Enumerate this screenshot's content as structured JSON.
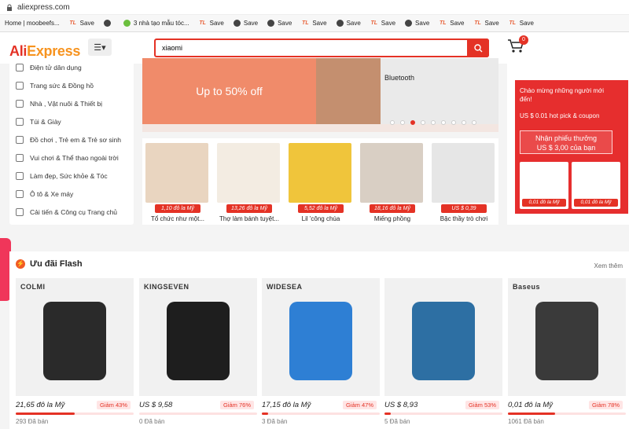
{
  "browser": {
    "url": "aliexpress.com",
    "bookmarks": [
      {
        "icon": "home-icon",
        "label": "Home | moobeefs..."
      },
      {
        "icon": "tl-icon",
        "label": "Save"
      },
      {
        "icon": "globe-icon",
        "label": ""
      },
      {
        "icon": "check-icon",
        "label": "3 nhà tạo mẫu tóc..."
      },
      {
        "icon": "tl-icon",
        "label": "Save"
      },
      {
        "icon": "globe-icon",
        "label": "Save"
      },
      {
        "icon": "globe-icon",
        "label": "Save"
      },
      {
        "icon": "tl-icon",
        "label": "Save"
      },
      {
        "icon": "globe-icon",
        "label": "Save"
      },
      {
        "icon": "tl-icon",
        "label": "Save"
      },
      {
        "icon": "globe-icon",
        "label": "Save"
      },
      {
        "icon": "tl-icon",
        "label": "Save"
      },
      {
        "icon": "tl-icon",
        "label": "Save"
      },
      {
        "icon": "tl-icon",
        "label": "Save"
      }
    ]
  },
  "header": {
    "logo_main": "Ali",
    "logo_accent": "Express",
    "search_value": "xiaomi",
    "cart_count": "0"
  },
  "sidebar": {
    "items": [
      {
        "icon": "camera-icon",
        "label": "Điện tử dân dụng"
      },
      {
        "icon": "ring-icon",
        "label": "Trang sức & Đồng hồ"
      },
      {
        "icon": "home-icon",
        "label": "Nhà , Vật nuôi & Thiết bị"
      },
      {
        "icon": "bag-icon",
        "label": "Túi & Giày"
      },
      {
        "icon": "toy-icon",
        "label": "Đồ chơi , Trẻ em & Trẻ sơ sinh"
      },
      {
        "icon": "ball-icon",
        "label": "Vui chơi & Thể thao ngoài trời"
      },
      {
        "icon": "beauty-icon",
        "label": "Làm đẹp, Sức khỏe & Tóc"
      },
      {
        "icon": "car-icon",
        "label": "Ô tô & Xe máy"
      },
      {
        "icon": "tool-icon",
        "label": "Cải tiến & Công cụ Trang chủ"
      }
    ]
  },
  "banner": {
    "promo_text": "Up to 50% off",
    "product_label": "Bluetooth"
  },
  "strip": [
    {
      "tag": "1,10 đô la Mỹ",
      "name": "Tổ chức như một...",
      "color": "#e9d5c0"
    },
    {
      "tag": "13,26 đô la Mỹ",
      "name": "Thợ làm bánh tuyệt...",
      "color": "#f3ece2"
    },
    {
      "tag": "5,52 đô la Mỹ",
      "name": "Lil 'công chúa",
      "color": "#f0c53b"
    },
    {
      "tag": "18,16 đô la Mỹ",
      "name": "Miếng phồng",
      "color": "#d9cfc4"
    },
    {
      "tag": "US $ 0,39",
      "name": "Bậc thầy trò chơi",
      "color": "#e6e6e6"
    }
  ],
  "promo": {
    "welcome": "Chào mừng những người mới đến!",
    "deal": "US $ 0.01 hot pick & coupon",
    "coupon_line1": "Nhận phiếu thưởng",
    "coupon_line2": "US $ 3,00 của bạn",
    "mini_tags": [
      "0,01 đô la Mỹ",
      "0,01 đô la Mỹ"
    ]
  },
  "flash": {
    "title": "Ưu đãi Flash",
    "see_more": "Xem thêm",
    "items": [
      {
        "brand": "COLMI",
        "price": "21,65 đô la Mỹ",
        "discount": "Giảm 43%",
        "sold": "293 Đã bán",
        "sold_fraction": 0.5,
        "color": "#2a2a2a"
      },
      {
        "brand": "KINGSEVEN",
        "price": "US $ 9,58",
        "discount": "Giảm 76%",
        "sold": "0 Đã bán",
        "sold_fraction": 0.0,
        "color": "#1e1e1e"
      },
      {
        "brand": "WIDESEA",
        "price": "17,15 đô la Mỹ",
        "discount": "Giảm 47%",
        "sold": "3 Đã bán",
        "sold_fraction": 0.05,
        "color": "#2e7fd4"
      },
      {
        "brand": "",
        "price": "US $ 8,93",
        "discount": "Giảm 53%",
        "sold": "5 Đã bán",
        "sold_fraction": 0.05,
        "color": "#2d6fa3"
      },
      {
        "brand": "Baseus",
        "price": "0,01 đô la Mỹ",
        "discount": "Giảm 78%",
        "sold": "1061 Đã bán",
        "sold_fraction": 0.4,
        "color": "#3a3a3a"
      }
    ]
  },
  "colors": {
    "accent": "#e43225",
    "promo_red": "#e62e2e"
  }
}
